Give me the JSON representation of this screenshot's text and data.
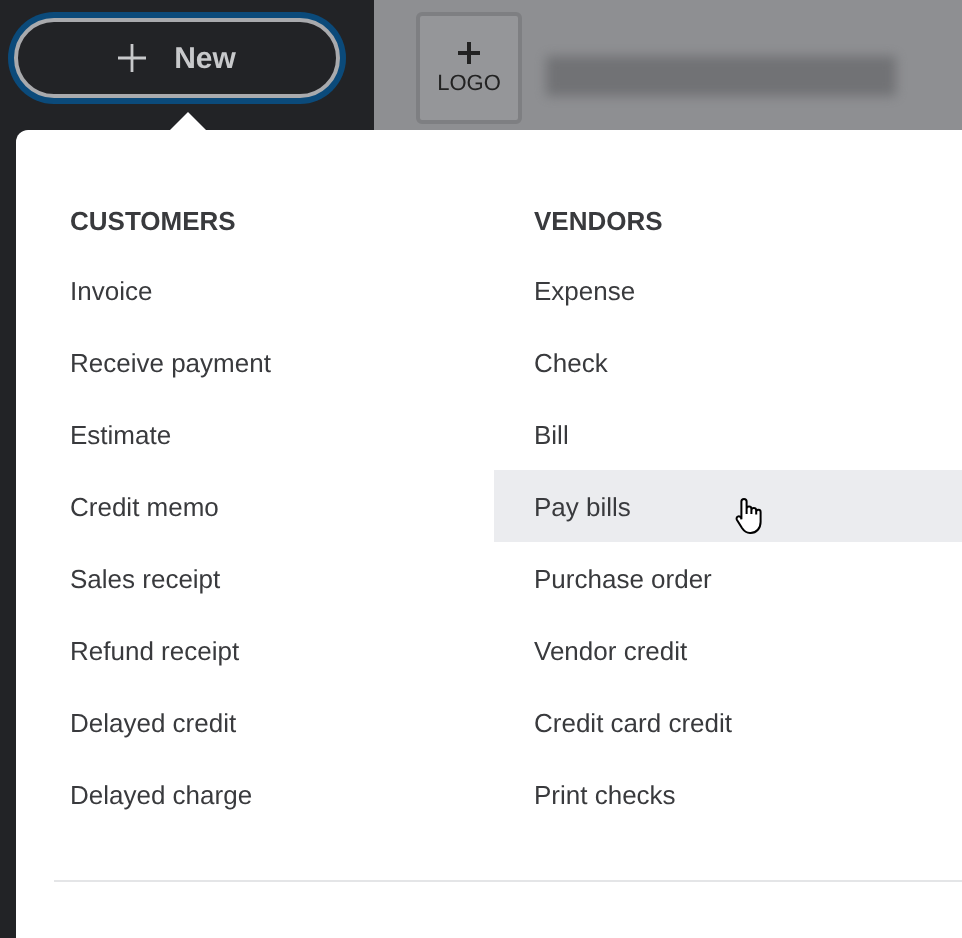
{
  "new_button": {
    "label": "New"
  },
  "logo_button": {
    "label": "LOGO"
  },
  "menu": {
    "columns": [
      {
        "heading": "CUSTOMERS",
        "items": [
          {
            "label": "Invoice",
            "hovered": false
          },
          {
            "label": "Receive payment",
            "hovered": false
          },
          {
            "label": "Estimate",
            "hovered": false
          },
          {
            "label": "Credit memo",
            "hovered": false
          },
          {
            "label": "Sales receipt",
            "hovered": false
          },
          {
            "label": "Refund receipt",
            "hovered": false
          },
          {
            "label": "Delayed credit",
            "hovered": false
          },
          {
            "label": "Delayed charge",
            "hovered": false
          }
        ]
      },
      {
        "heading": "VENDORS",
        "items": [
          {
            "label": "Expense",
            "hovered": false
          },
          {
            "label": "Check",
            "hovered": false
          },
          {
            "label": "Bill",
            "hovered": false
          },
          {
            "label": "Pay bills",
            "hovered": true
          },
          {
            "label": "Purchase order",
            "hovered": false
          },
          {
            "label": "Vendor credit",
            "hovered": false
          },
          {
            "label": "Credit card credit",
            "hovered": false
          },
          {
            "label": "Print checks",
            "hovered": false
          }
        ]
      }
    ]
  }
}
